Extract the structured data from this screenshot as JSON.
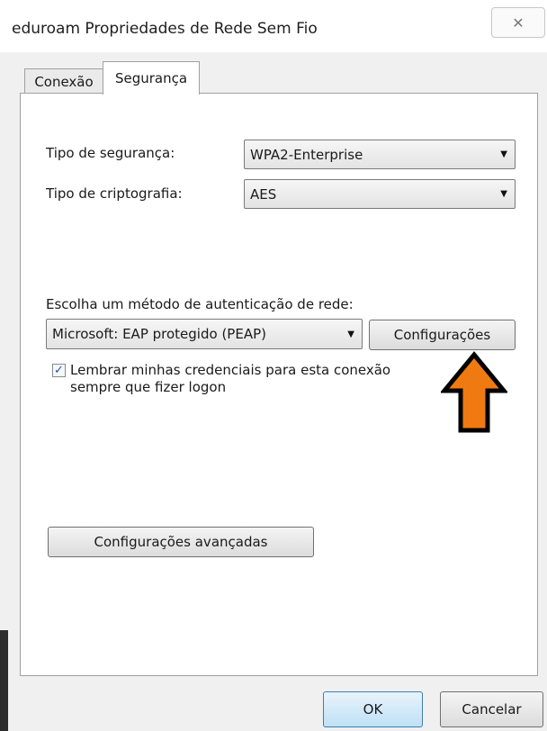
{
  "window": {
    "title": "eduroam Propriedades de Rede Sem Fio",
    "close_glyph": "✕"
  },
  "tabs": [
    {
      "label": "Conexão",
      "selected": false
    },
    {
      "label": "Segurança",
      "selected": true
    }
  ],
  "security": {
    "security_type_label": "Tipo de segurança:",
    "security_type_value": "WPA2-Enterprise",
    "encryption_type_label": "Tipo de criptografia:",
    "encryption_type_value": "AES",
    "auth_method_label": "Escolha um método de autenticação de rede:",
    "auth_method_value": "Microsoft: EAP protegido (PEAP)",
    "settings_button": "Configurações",
    "remember_checked": true,
    "remember_label": "Lembrar minhas credenciais para esta conexão sempre que fizer logon",
    "advanced_button": "Configurações avançadas"
  },
  "footer": {
    "ok_label": "OK",
    "cancel_label": "Cancelar"
  },
  "icons": {
    "dropdown": "chevron-down-icon",
    "check": "checkmark-icon",
    "annotation": "up-arrow-icon"
  },
  "colors": {
    "annotation_arrow": "#f07a12",
    "default_button_border": "#3c7fb1"
  }
}
